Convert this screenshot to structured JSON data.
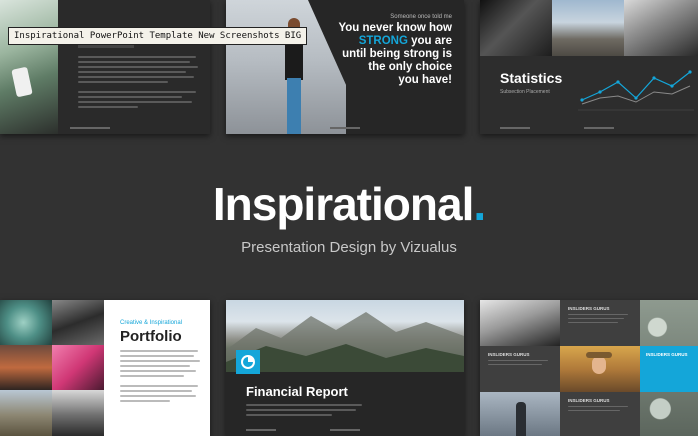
{
  "caption": "Inspirational PowerPoint Template New Screenshots BIG",
  "hero": {
    "title": "Inspirational",
    "dot": ".",
    "subtitle": "Presentation Design by Vizualus"
  },
  "slide_quote": {
    "small": "Someone once told me",
    "line1": "You never know how",
    "line2": "STRONG",
    "line2b": " you are",
    "line3": "until being strong is",
    "line4": "the only choice",
    "line5": "you have!"
  },
  "slide_stats": {
    "title": "Statistics",
    "subtitle": "Subsection Placement"
  },
  "slide_portfolio": {
    "kicker": "Creative & Inspirational",
    "title": "Portfolio"
  },
  "slide_financial": {
    "title": "Financial Report"
  },
  "slide_grid": {
    "label": "INSLIDERS GURUS"
  },
  "colors": {
    "accent": "#14a6d9",
    "dark": "#2b2b2b",
    "background": "#323232"
  }
}
